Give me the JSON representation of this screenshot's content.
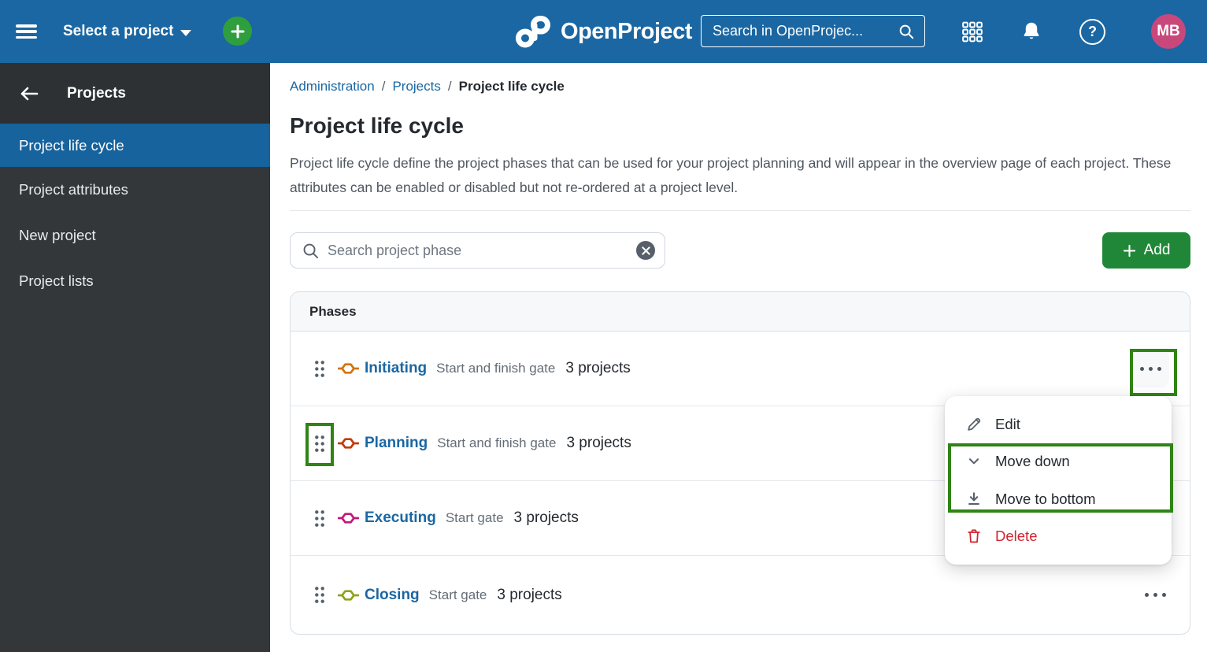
{
  "theme": {
    "header_blue": "#1A67A3",
    "sidebar_bg": "#333739",
    "active_item_blue": "#17639D",
    "link_blue": "#1A67A3",
    "add_green": "#218738",
    "plus_green": "#2E9E3E",
    "avatar_pink": "#C9487C",
    "annotation_green": "#2F8415",
    "delete_red": "#D1242F"
  },
  "icons": [
    "hamburger-icon",
    "plus-icon",
    "openproject-logo",
    "search-icon",
    "modules-grid-icon",
    "bell-icon",
    "help-icon",
    "back-arrow-icon",
    "grip-icon",
    "gate-icon",
    "clear-icon",
    "ellipsis-icon",
    "pencil-icon",
    "chevron-down-icon",
    "move-to-bottom-icon",
    "trash-icon"
  ],
  "topbar": {
    "select_project_label": "Select a project",
    "logo_text": "OpenProject",
    "search_placeholder": "Search in OpenProjec...",
    "avatar_initials": "MB"
  },
  "sidebar": {
    "title": "Projects",
    "items": [
      {
        "label": "Project life cycle",
        "active": true
      },
      {
        "label": "Project attributes",
        "active": false
      },
      {
        "label": "New project",
        "active": false
      },
      {
        "label": "Project lists",
        "active": false
      }
    ]
  },
  "main": {
    "breadcrumb": {
      "links": [
        "Administration",
        "Projects"
      ],
      "separator": "/",
      "current": "Project life cycle"
    },
    "title": "Project life cycle",
    "description": "Project life cycle define the project phases that can be used for your project planning and will appear in the overview page of each project. These attributes can be enabled or disabled but not re-ordered at a project level.",
    "search_placeholder": "Search project phase",
    "add_label": "Add",
    "table": {
      "header": "Phases",
      "rows": [
        {
          "name": "Initiating",
          "gate": "Start and finish gate",
          "projects": "3 projects",
          "color": "#D3740B"
        },
        {
          "name": "Planning",
          "gate": "Start and finish gate",
          "projects": "3 projects",
          "color": "#C23A0B"
        },
        {
          "name": "Executing",
          "gate": "Start gate",
          "projects": "3 projects",
          "color": "#C01A7A"
        },
        {
          "name": "Closing",
          "gate": "Start gate",
          "projects": "3 projects",
          "color": "#8FA31F"
        }
      ]
    },
    "context_menu": {
      "items": [
        {
          "label": "Edit"
        },
        {
          "label": "Move down"
        },
        {
          "label": "Move to bottom"
        },
        {
          "label": "Delete",
          "danger": true
        }
      ]
    }
  }
}
